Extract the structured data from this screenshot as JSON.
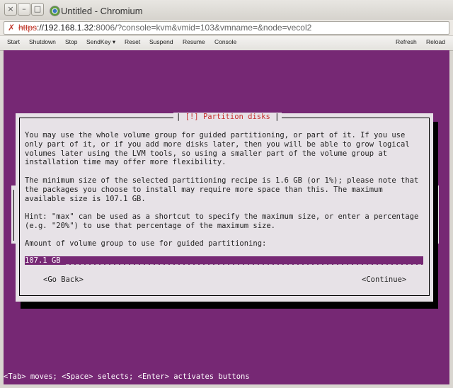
{
  "window": {
    "title": "Untitled - Chromium",
    "buttons": {
      "close": "×",
      "minimize": "–",
      "maximize": "□"
    }
  },
  "address": {
    "scheme": "https",
    "host": "://192.168.1.32",
    "rest": ":8006/?console=kvm&vmid=103&vmname=&node=vecol2"
  },
  "toolbar": {
    "items": [
      "Start",
      "Shutdown",
      "Stop",
      "SendKey ▾",
      "Reset",
      "Suspend",
      "Resume",
      "Console"
    ],
    "refresh": "Refresh",
    "reload": "Reload"
  },
  "dialog": {
    "title_prefix": "[!] ",
    "title": "Partition disks",
    "para1": "You may use the whole volume group for guided partitioning, or part of it. If you use\nonly part of it, or if you add more disks later, then you will be able to grow logical\nvolumes later using the LVM tools, so using a smaller part of the volume group at\ninstallation time may offer more flexibility.",
    "para2": "The minimum size of the selected partitioning recipe is 1.6 GB (or 1%); please note that\nthe packages you choose to install may require more space than this. The maximum\navailable size is 107.1 GB.",
    "para3": "Hint: \"max\" can be used as a shortcut to specify the maximum size, or enter a percentage\n(e.g. \"20%\") to use that percentage of the maximum size.",
    "prompt": "Amount of volume group to use for guided partitioning:",
    "input_value": "107.1 GB",
    "go_back": "<Go Back>",
    "continue": "<Continue>"
  },
  "status_line": "<Tab> moves; <Space> selects; <Enter> activates buttons",
  "colors": {
    "console_bg": "#762874",
    "dialog_bg": "#e7e2e7",
    "title_red": "#c53030"
  }
}
